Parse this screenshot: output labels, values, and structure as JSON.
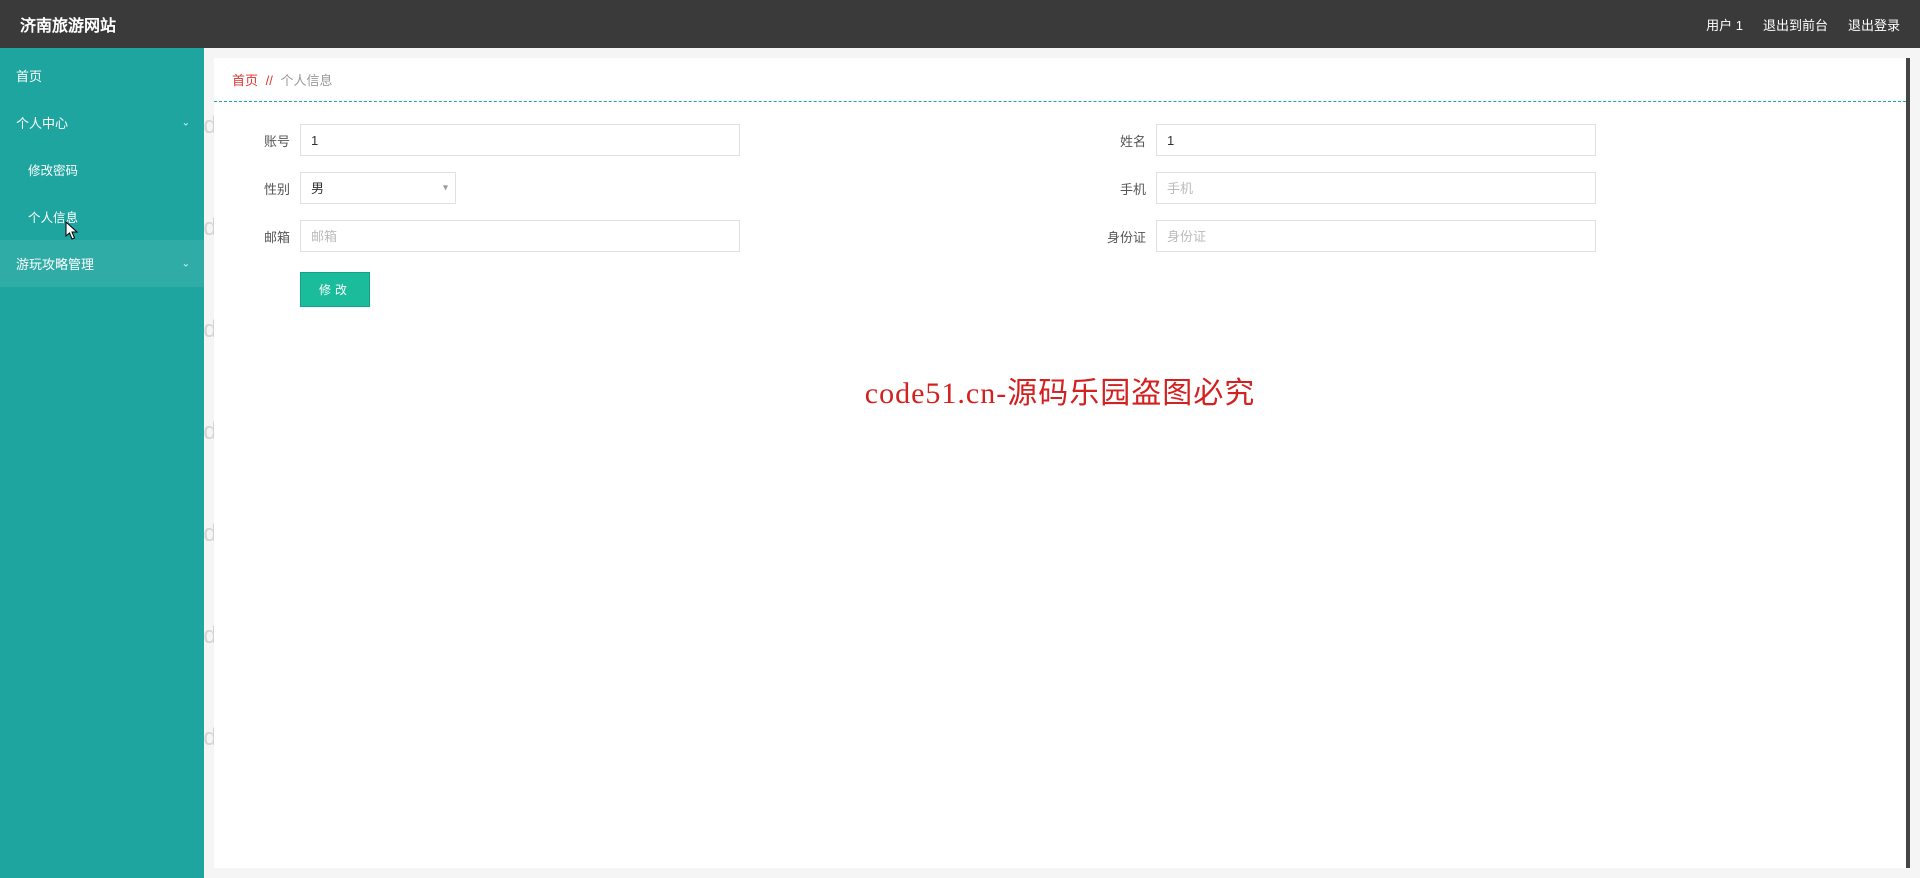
{
  "header": {
    "brand": "济南旅游网站",
    "user_label": "用户 1",
    "logout_front": "退出到前台",
    "logout": "退出登录"
  },
  "sidebar": {
    "home": "首页",
    "personal_center": "个人中心",
    "change_password": "修改密码",
    "personal_info": "个人信息",
    "guide_manage": "游玩攻略管理"
  },
  "breadcrumb": {
    "home": "首页",
    "sep": "//",
    "current": "个人信息"
  },
  "form": {
    "account_label": "账号",
    "account_value": "1",
    "name_label": "姓名",
    "name_value": "1",
    "gender_label": "性别",
    "gender_value": "男",
    "phone_label": "手机",
    "phone_placeholder": "手机",
    "phone_value": "",
    "email_label": "邮箱",
    "email_placeholder": "邮箱",
    "email_value": "",
    "idcard_label": "身份证",
    "idcard_placeholder": "身份证",
    "idcard_value": "",
    "submit": "修改"
  },
  "watermark": {
    "text": "code51.cn",
    "center": "code51.cn-源码乐园盗图必究"
  }
}
